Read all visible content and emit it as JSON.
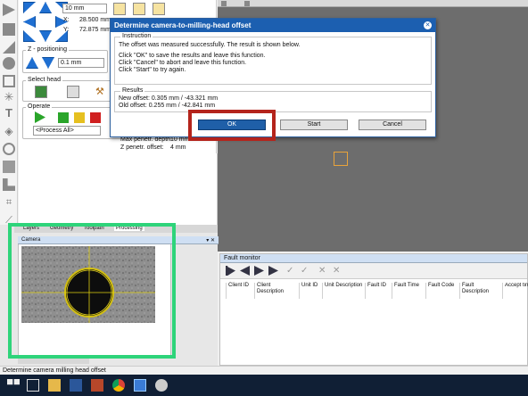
{
  "left_panel": {
    "step_value": "10 mm",
    "x_label": "X:",
    "x_value": "28.500 mm",
    "y_label": "Y:",
    "y_value": "72.875 mm",
    "z_section": "Z - positioning",
    "z_value": "0.1 mm",
    "select_head_section": "Select head",
    "operate_section": "Operate",
    "process_select": "<Process All>",
    "max_depth_label": "Max penetr. depth:",
    "max_depth_value": "10 mm",
    "z_offset_label": "Z penetr. offset:",
    "z_offset_value": "4 mm"
  },
  "dialog": {
    "title": "Determine camera-to-milling-head offset",
    "instruction_group": "Instruction",
    "instruction_lines": [
      "The offset was measured successfully. The result is shown below.",
      "",
      "Click \"OK\" to save the results and leave this function.",
      "Click \"Cancel\" to abort and leave this function.",
      "Click \"Start\" to try again."
    ],
    "results_group": "Results",
    "new_offset": "New offset: 0.305 mm / -43.321 mm",
    "old_offset": "Old offset: 0.255 mm / -42.841 mm",
    "ok_label": "OK",
    "start_label": "Start",
    "cancel_label": "Cancel"
  },
  "camera": {
    "tabs": [
      "Layers",
      "Geometry",
      "Toolpath",
      "Processing"
    ],
    "title": "Camera"
  },
  "fault_monitor": {
    "title": "Fault monitor",
    "columns": [
      "Client ID",
      "Client Description",
      "Unit ID",
      "Unit Description",
      "Fault ID",
      "Fault Time",
      "Fault Code",
      "Fault Description",
      "Accept time"
    ]
  },
  "status_text": "Determine camera milling head offset",
  "colors": {
    "dialog_title": "#1c5fb0",
    "ok_button": "#1f5fa8",
    "highlight_red": "#b4241c",
    "highlight_green": "#2ed47a",
    "canvas_gray": "#6d6d6d",
    "marker_orange": "#e8a33a"
  }
}
